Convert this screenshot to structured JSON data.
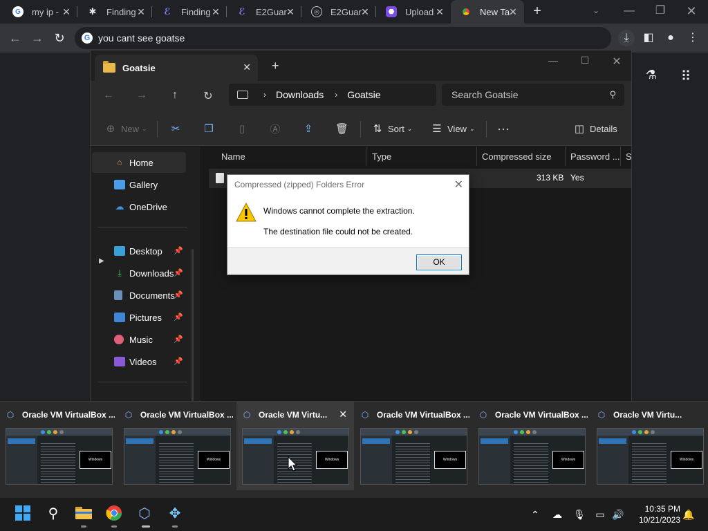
{
  "chrome": {
    "tabs": [
      {
        "title": "my ip -",
        "favicon": "google-icon"
      },
      {
        "title": "Finding",
        "favicon": "github-icon"
      },
      {
        "title": "Finding",
        "favicon": "e2guardian-icon"
      },
      {
        "title": "E2Guar",
        "favicon": "e2guardian-icon"
      },
      {
        "title": "E2Guar",
        "favicon": "globe-icon"
      },
      {
        "title": "Upload",
        "favicon": "upload-icon"
      },
      {
        "title": "New Ta",
        "favicon": "chrome-icon"
      }
    ],
    "omnibox_text": "you cant see goatse"
  },
  "explorer": {
    "tab_title": "Goatsie",
    "breadcrumbs": [
      "Downloads",
      "Goatsie"
    ],
    "search_placeholder": "Search Goatsie",
    "commands": {
      "new": "New",
      "sort": "Sort",
      "view": "View",
      "details": "Details"
    },
    "sidebar": [
      {
        "label": "Home",
        "icon": "home-icon"
      },
      {
        "label": "Gallery",
        "icon": "gallery-icon"
      },
      {
        "label": "OneDrive",
        "icon": "cloud-icon"
      },
      {
        "label": "Desktop",
        "icon": "desktop-icon"
      },
      {
        "label": "Downloads",
        "icon": "download-icon"
      },
      {
        "label": "Documents",
        "icon": "document-icon"
      },
      {
        "label": "Pictures",
        "icon": "pictures-icon"
      },
      {
        "label": "Music",
        "icon": "music-icon"
      },
      {
        "label": "Videos",
        "icon": "videos-icon"
      }
    ],
    "columns": [
      "Name",
      "Type",
      "Compressed size",
      "Password ...",
      "Si"
    ],
    "row": {
      "compressed_size": "313 KB",
      "password": "Yes"
    }
  },
  "dialog": {
    "title": "Compressed (zipped) Folders Error",
    "message1": "Windows cannot complete the extraction.",
    "message2": "The destination file could not be created.",
    "ok_label": "OK"
  },
  "thumbnails": [
    {
      "title": "Oracle VM VirtualBox ..."
    },
    {
      "title": "Oracle VM VirtualBox ..."
    },
    {
      "title": "Oracle VM Virtu..."
    },
    {
      "title": "Oracle VM VirtualBox ..."
    },
    {
      "title": "Oracle VM VirtualBox ..."
    },
    {
      "title": "Oracle VM Virtu..."
    }
  ],
  "taskbar": {
    "time": "10:35 PM",
    "date": "10/21/2023"
  },
  "colors": {
    "accent": "#0078d4",
    "chrome_dark": "#202124",
    "folder": "#e8b84a",
    "warning": "#f7c600"
  }
}
